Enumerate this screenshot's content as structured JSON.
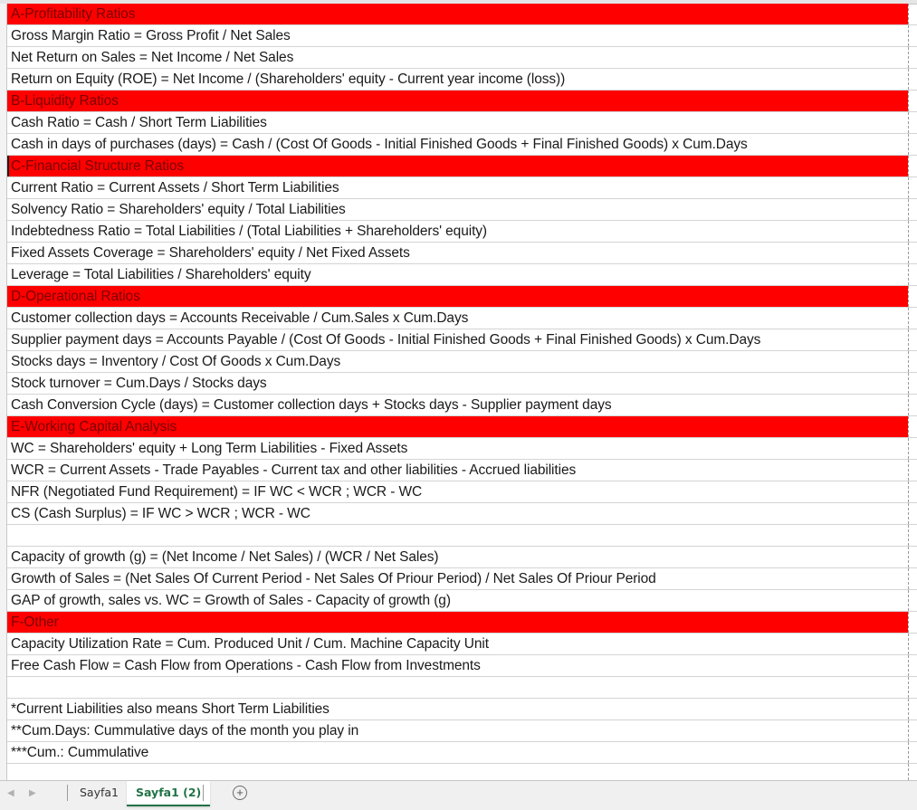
{
  "rows": [
    {
      "type": "header",
      "text": "A-Profitability Ratios"
    },
    {
      "type": "text",
      "text": "Gross Margin Ratio = Gross Profit / Net Sales"
    },
    {
      "type": "text",
      "text": "Net Return on Sales = Net Income / Net Sales"
    },
    {
      "type": "text",
      "text": "Return on Equity (ROE) = Net Income / (Shareholders' equity - Current year income (loss))"
    },
    {
      "type": "header",
      "text": "B-Liquidity Ratios"
    },
    {
      "type": "text",
      "text": "Cash Ratio = Cash / Short Term Liabilities"
    },
    {
      "type": "text",
      "text": "Cash in days of purchases (days) = Cash / (Cost Of Goods - Initial Finished Goods + Final Finished Goods) x Cum.Days"
    },
    {
      "type": "header",
      "text": "C-Financial Structure Ratios",
      "selected": true
    },
    {
      "type": "text",
      "text": "Current Ratio = Current Assets / Short Term Liabilities"
    },
    {
      "type": "text",
      "text": "Solvency Ratio = Shareholders' equity / Total Liabilities"
    },
    {
      "type": "text",
      "text": "Indebtedness Ratio = Total Liabilities / (Total Liabilities + Shareholders' equity)"
    },
    {
      "type": "text",
      "text": "Fixed Assets Coverage = Shareholders' equity / Net Fixed Assets"
    },
    {
      "type": "text",
      "text": "Leverage = Total Liabilities / Shareholders' equity"
    },
    {
      "type": "header",
      "text": "D-Operational Ratios"
    },
    {
      "type": "text",
      "text": "Customer collection days = Accounts Receivable / Cum.Sales x Cum.Days"
    },
    {
      "type": "text",
      "text": "Supplier payment days = Accounts Payable / (Cost Of Goods - Initial Finished Goods + Final Finished Goods) x Cum.Days"
    },
    {
      "type": "text",
      "text": "Stocks days = Inventory / Cost Of Goods x Cum.Days"
    },
    {
      "type": "text",
      "text": "Stock turnover = Cum.Days / Stocks days"
    },
    {
      "type": "text",
      "text": "Cash Conversion Cycle (days) = Customer collection days + Stocks days - Supplier payment days"
    },
    {
      "type": "header",
      "text": "E-Working Capital Analysis"
    },
    {
      "type": "text",
      "text": "WC = Shareholders' equity + Long Term Liabilities - Fixed Assets"
    },
    {
      "type": "text",
      "text": "WCR = Current Assets - Trade Payables - Current tax and other liabilities - Accrued liabilities"
    },
    {
      "type": "text",
      "text": "NFR (Negotiated Fund Requirement) = IF WC < WCR ; WCR - WC"
    },
    {
      "type": "text",
      "text": "CS (Cash Surplus) = IF WC > WCR ; WCR - WC"
    },
    {
      "type": "text",
      "text": ""
    },
    {
      "type": "text",
      "text": "Capacity of growth (g) = (Net Income / Net Sales) / (WCR / Net Sales)"
    },
    {
      "type": "text",
      "text": "Growth of Sales = (Net Sales Of Current Period - Net Sales Of Priour Period) / Net Sales Of Priour Period"
    },
    {
      "type": "text",
      "text": "GAP of growth, sales vs. WC = Growth of Sales - Capacity of growth (g)"
    },
    {
      "type": "header",
      "text": "F-Other"
    },
    {
      "type": "text",
      "text": "Capacity Utilization Rate = Cum. Produced Unit / Cum. Machine Capacity Unit"
    },
    {
      "type": "text",
      "text": "Free Cash Flow = Cash Flow from Operations - Cash Flow from Investments"
    },
    {
      "type": "text",
      "text": ""
    },
    {
      "type": "text",
      "text": "*Current Liabilities also means Short Term Liabilities"
    },
    {
      "type": "text",
      "text": "**Cum.Days: Cummulative days of the month you play in"
    },
    {
      "type": "text",
      "text": "***Cum.: Cummulative"
    },
    {
      "type": "text",
      "text": ""
    }
  ],
  "tabs": {
    "sheet1": "Sayfa1",
    "sheet2": "Sayfa1 (2)",
    "add_symbol": "+",
    "nav_prev": "◀",
    "nav_next": "▶"
  },
  "colors": {
    "header_fill": "#ff0000",
    "active_tab": "#217346"
  }
}
